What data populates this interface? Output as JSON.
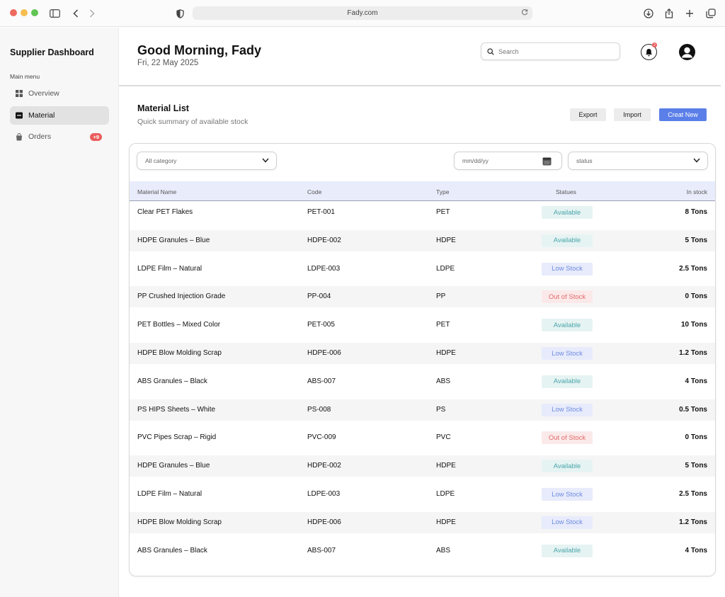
{
  "browser": {
    "url": "Fady.com"
  },
  "sidebar": {
    "title": "Supplier Dashboard",
    "menu_label": "Main menu",
    "items": [
      {
        "label": "Overview",
        "icon": "grid-icon",
        "active": false
      },
      {
        "label": "Material",
        "icon": "box-icon",
        "active": true
      },
      {
        "label": "Orders",
        "icon": "bag-icon",
        "active": false,
        "badge": "+9"
      }
    ]
  },
  "header": {
    "greeting": "Good Morning, Fady",
    "date": "Fri, 22 May 2025",
    "search_placeholder": "Search",
    "notification_count": "2"
  },
  "section": {
    "title": "Material List",
    "subtitle": "Quick summary of available stock",
    "export_label": "Export",
    "import_label": "Import",
    "create_label": "Creat New"
  },
  "filters": {
    "category": "All category",
    "date_placeholder": "mm/dd/yy",
    "status": "status"
  },
  "table": {
    "columns": [
      "Material Name",
      "Code",
      "Type",
      "Statues",
      "In stock"
    ],
    "rows": [
      {
        "name": "Clear PET Flakes",
        "code": "PET-001",
        "type": "PET",
        "status": "Available",
        "stock": "8 Tons"
      },
      {
        "name": "HDPE Granules – Blue",
        "code": "HDPE-002",
        "type": "HDPE",
        "status": "Available",
        "stock": "5 Tons"
      },
      {
        "name": "LDPE Film – Natural",
        "code": "LDPE-003",
        "type": "LDPE",
        "status": "Low Stock",
        "stock": "2.5 Tons"
      },
      {
        "name": "PP Crushed Injection Grade",
        "code": "PP-004",
        "type": "PP",
        "status": "Out of Stock",
        "stock": "0 Tons"
      },
      {
        "name": "PET Bottles – Mixed Color",
        "code": "PET-005",
        "type": "PET",
        "status": "Available",
        "stock": "10 Tons"
      },
      {
        "name": "HDPE Blow Molding Scrap",
        "code": "HDPE-006",
        "type": "HDPE",
        "status": "Low Stock",
        "stock": "1.2 Tons"
      },
      {
        "name": "ABS Granules – Black",
        "code": "ABS-007",
        "type": "ABS",
        "status": "Available",
        "stock": "4 Tons"
      },
      {
        "name": "PS HIPS Sheets – White",
        "code": "PS-008",
        "type": "PS",
        "status": "Low Stock",
        "stock": "0.5 Tons"
      },
      {
        "name": "PVC Pipes Scrap – Rigid",
        "code": "PVC-009",
        "type": "PVC",
        "status": "Out of Stock",
        "stock": "0 Tons"
      },
      {
        "name": "HDPE Granules – Blue",
        "code": "HDPE-002",
        "type": "HDPE",
        "status": "Available",
        "stock": "5 Tons"
      },
      {
        "name": "LDPE Film – Natural",
        "code": "LDPE-003",
        "type": "LDPE",
        "status": "Low Stock",
        "stock": "2.5 Tons"
      },
      {
        "name": "HDPE Blow Molding Scrap",
        "code": "HDPE-006",
        "type": "HDPE",
        "status": "Low Stock",
        "stock": "1.2 Tons"
      },
      {
        "name": "ABS Granules – Black",
        "code": "ABS-007",
        "type": "ABS",
        "status": "Available",
        "stock": "4 Tons"
      }
    ]
  },
  "colors": {
    "accent": "#5b7fe8",
    "available": "#4aa6aa",
    "low_stock": "#6f8be0",
    "out_of_stock": "#e26b6b",
    "badge": "#ea5c5c"
  }
}
